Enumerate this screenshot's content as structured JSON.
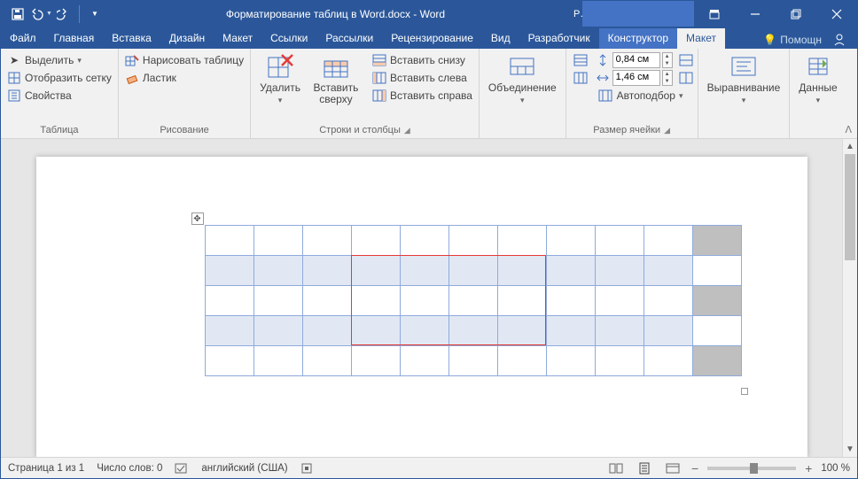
{
  "title": "Форматирование таблиц в Word.docx - Word",
  "context_tab_group": "Р…",
  "qat": {
    "save": "save-icon",
    "undo": "undo-icon",
    "redo": "redo-icon"
  },
  "window_controls": {
    "ribbon_opts": "ribbon-display-options",
    "min": "minimize",
    "max": "restore",
    "close": "close"
  },
  "tabs": {
    "file": "Файл",
    "home": "Главная",
    "insert": "Вставка",
    "design": "Дизайн",
    "layout": "Макет",
    "references": "Ссылки",
    "mailings": "Рассылки",
    "review": "Рецензирование",
    "view": "Вид",
    "developer": "Разработчик",
    "table_design": "Конструктор",
    "table_layout": "Макет",
    "tell_me": "Помощн",
    "share": "share-icon"
  },
  "ribbon": {
    "table": {
      "label": "Таблица",
      "select": "Выделить",
      "gridlines": "Отобразить сетку",
      "properties": "Свойства"
    },
    "draw": {
      "label": "Рисование",
      "draw_table": "Нарисовать таблицу",
      "eraser": "Ластик"
    },
    "rows_cols": {
      "label": "Строки и столбцы",
      "delete": "Удалить",
      "insert_above": "Вставить сверху",
      "insert_below": "Вставить снизу",
      "insert_left": "Вставить слева",
      "insert_right": "Вставить справа"
    },
    "merge": {
      "label": "Объединение"
    },
    "cell_size": {
      "label": "Размер ячейки",
      "height": "0,84 см",
      "width": "1,46 см",
      "autofit": "Автоподбор"
    },
    "alignment": {
      "label": "Выравнивание"
    },
    "data": {
      "label": "Данные"
    }
  },
  "document": {
    "table": {
      "rows": 5,
      "cols": 11
    },
    "selection": {
      "row_start": 2,
      "row_end": 4,
      "col_start": 4,
      "col_end": 7
    }
  },
  "status": {
    "page": "Страница 1 из 1",
    "words": "Число слов: 0",
    "lang": "английский (США)",
    "zoom": "100 %"
  }
}
